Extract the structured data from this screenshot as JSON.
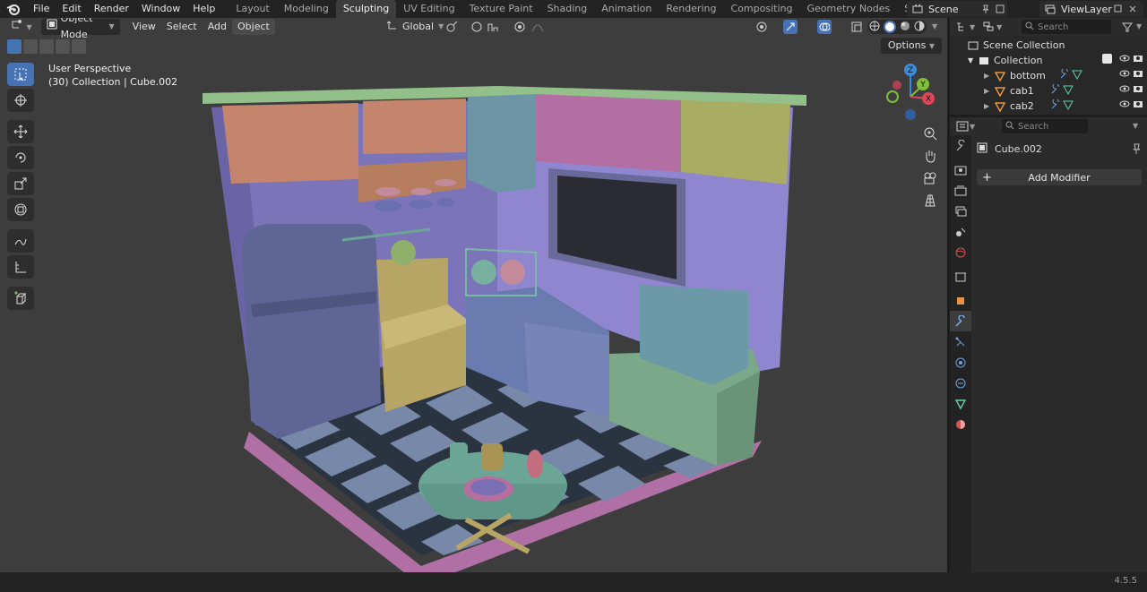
{
  "top_menu": [
    "File",
    "Edit",
    "Render",
    "Window",
    "Help"
  ],
  "workspace_tabs": [
    {
      "label": "Layout",
      "active": false
    },
    {
      "label": "Modeling",
      "active": false
    },
    {
      "label": "Sculpting",
      "active": true
    },
    {
      "label": "UV Editing",
      "active": false
    },
    {
      "label": "Texture Paint",
      "active": false
    },
    {
      "label": "Shading",
      "active": false
    },
    {
      "label": "Animation",
      "active": false
    },
    {
      "label": "Rendering",
      "active": false
    },
    {
      "label": "Compositing",
      "active": false
    },
    {
      "label": "Geometry Nodes",
      "active": false
    },
    {
      "label": "Scripting",
      "active": false
    }
  ],
  "scene": {
    "name": "Scene"
  },
  "view_layer": {
    "name": "ViewLayer"
  },
  "viewport": {
    "mode": "Object Mode",
    "menus": [
      "View",
      "Select",
      "Add",
      "Object"
    ],
    "transform_orientation": "Global",
    "options_label": "Options",
    "info_line1": "User Perspective",
    "info_line2": "(30) Collection | Cube.002"
  },
  "gizmo": {
    "z": "Z",
    "y": "Y",
    "x": "X"
  },
  "outliner": {
    "search_placeholder": "Search",
    "root": "Scene Collection",
    "collection": "Collection",
    "items": [
      "bottom",
      "cab1",
      "cab2"
    ]
  },
  "properties": {
    "search_placeholder": "Search",
    "object_name": "Cube.002",
    "add_modifier_label": "Add Modifier"
  },
  "status": {
    "version": "4.5.5"
  },
  "colors": {
    "accent": "#4772b3",
    "viewport_bg": "#3d3d3d",
    "gizmo_x": "#e0455a",
    "gizmo_y": "#7fbf3b",
    "gizmo_z": "#3c8bd9"
  }
}
